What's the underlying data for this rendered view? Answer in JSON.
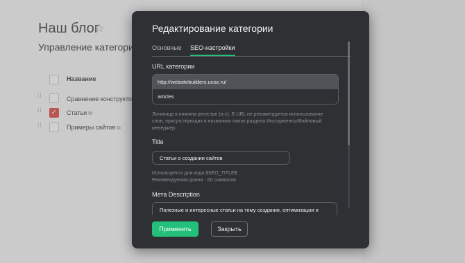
{
  "background": {
    "blog_title": "Наш блог",
    "subtitle": "Управление категориям",
    "column_header": "Название",
    "rows": [
      {
        "label": "Сравнение конструктор",
        "checked": false,
        "has_link_icon": false
      },
      {
        "label": "Статьи",
        "checked": true,
        "has_link_icon": true
      },
      {
        "label": "Примеры сайтов",
        "checked": false,
        "has_link_icon": true
      }
    ]
  },
  "modal": {
    "title": "Редактирование категории",
    "tabs": [
      {
        "label": "Основные",
        "active": false
      },
      {
        "label": "SEO-настройки",
        "active": true
      }
    ],
    "url": {
      "label": "URL категории",
      "prefix": "http://websitebuilders.ucoz.ru/",
      "value": "articles",
      "hint": "Латиница в нижнем регистре (a-z). В URL не рекомендуется использование слов, присутствующих в названиях папок раздела Инструменты/Файловый менеджер."
    },
    "title_field": {
      "label": "Title",
      "value": "Статьи о создании сайтов",
      "hint_line1": "Используется для кода $SEO_TITLE$",
      "hint_line2": "Рекомендуемая длина - 60 символов"
    },
    "meta_description": {
      "label": "Мета Description",
      "value": "Полезные и интересные статьи на тему создания, оптимизации и"
    },
    "buttons": {
      "apply": "Применить",
      "close": "Закрыть"
    }
  },
  "colors": {
    "accent": "#22c07a",
    "modal_bg": "#2e3034",
    "checkbox_checked": "#e0433e"
  }
}
